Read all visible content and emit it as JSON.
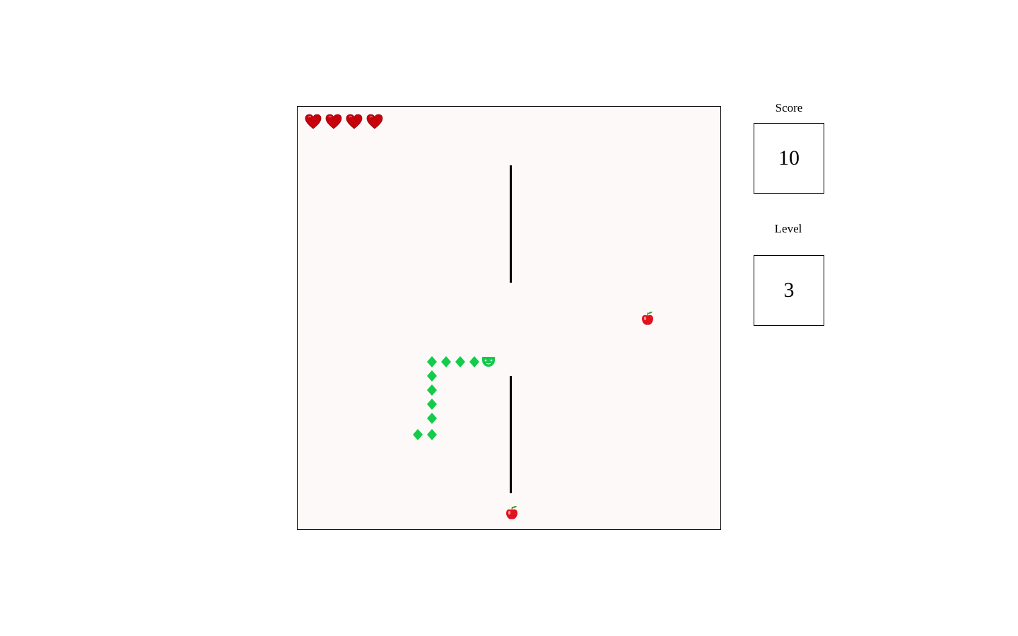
{
  "game": {
    "lives": 4,
    "snake": {
      "color": "#12cc4a",
      "segments": 10
    },
    "apples": 2,
    "walls": 2
  },
  "scoreboard": {
    "score_label": "Score",
    "score_value": "10",
    "level_label": "Level",
    "level_value": "3"
  },
  "icons": {
    "life": "heart-icon",
    "food": "apple-icon",
    "snake_head": "snake-head-icon",
    "snake_body": "snake-segment-icon"
  },
  "colors": {
    "heart": "#c8000c",
    "apple": "#e0141e",
    "board_background": "#fdf9f8"
  }
}
